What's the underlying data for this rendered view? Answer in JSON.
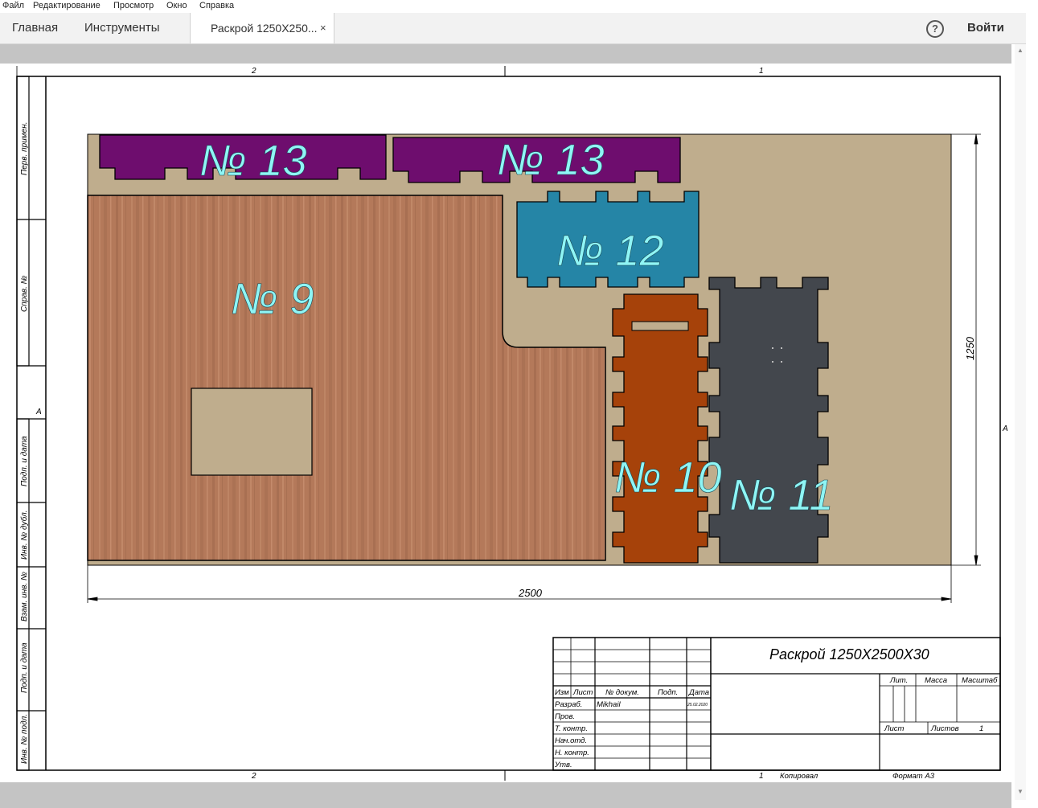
{
  "menu": {
    "items": [
      "Файл",
      "Редактирование",
      "Просмотр",
      "Окно",
      "Справка"
    ]
  },
  "tabs": {
    "home": "Главная",
    "tools": "Инструменты",
    "document": "Раскрой 1250X250...",
    "close_glyph": "×"
  },
  "header": {
    "help_glyph": "?",
    "login": "Войти"
  },
  "drawing": {
    "zone_top_left": "2",
    "zone_top_right": "1",
    "zone_bottom_left": "2",
    "zone_bottom_right": "1",
    "zone_side_a_left": "A",
    "zone_side_a_right": "A",
    "side_stamps": [
      "Перв. примен.",
      "Справ. №",
      "Подп. и дата",
      "Инв. № дубл.",
      "Взам. инв. №",
      "Подп. и дата",
      "Инв. № подл."
    ],
    "dimension_width": "2500",
    "dimension_height": "1250",
    "parts": [
      {
        "label": "№ 13",
        "color": "#6e0d6e"
      },
      {
        "label": "№ 13",
        "color": "#6e0d6e"
      },
      {
        "label": "№ 12",
        "color": "#2585a6"
      },
      {
        "label": "№ 9",
        "color": "#b07a5a"
      },
      {
        "label": "№ 10",
        "color": "#a6420a"
      },
      {
        "label": "№ 11",
        "color": "#43474d"
      }
    ],
    "sheet_color": "#bfad8d",
    "label_color": "#8ff5f5"
  },
  "title_block": {
    "title": "Раскрой 1250X2500X30",
    "col_headers": [
      "Изм",
      "Лист",
      "№ докум.",
      "Подп.",
      "Дата"
    ],
    "row_labels": [
      "Разраб.",
      "Пров.",
      "Т. контр.",
      "Нач.отд.",
      "Н. контр.",
      "Утв."
    ],
    "developer": "Mikhail",
    "date": "25.02.2020",
    "lit": "Лит.",
    "mass": "Масса",
    "scale": "Масштаб",
    "sheet": "Лист",
    "sheets": "Листов",
    "sheets_count": "1",
    "copied": "Копировал",
    "format": "Формат A3"
  }
}
